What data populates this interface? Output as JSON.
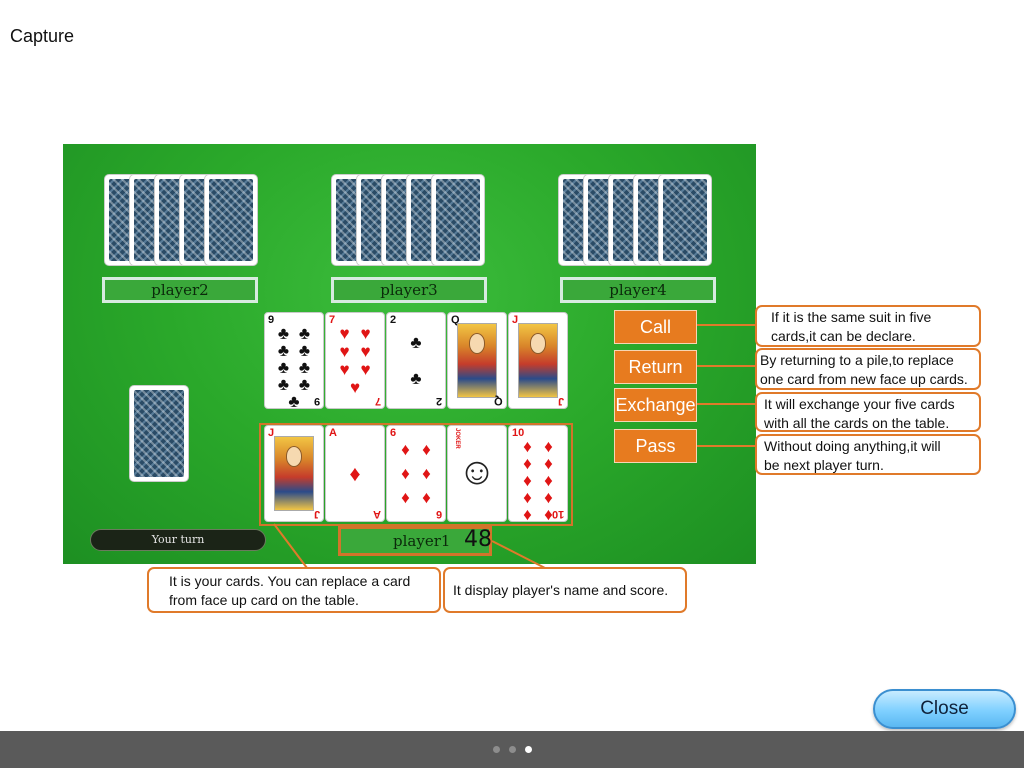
{
  "page": {
    "title": "Capture"
  },
  "opponents": [
    {
      "name": "player2"
    },
    {
      "name": "player3"
    },
    {
      "name": "player4"
    }
  ],
  "table_cards": [
    {
      "rank": "9",
      "suit": "clubs"
    },
    {
      "rank": "7",
      "suit": "hearts"
    },
    {
      "rank": "2",
      "suit": "clubs"
    },
    {
      "rank": "Q",
      "suit": "clubs"
    },
    {
      "rank": "J",
      "suit": "hearts"
    }
  ],
  "hand_cards": [
    {
      "rank": "J",
      "suit": "diamonds"
    },
    {
      "rank": "A",
      "suit": "diamonds"
    },
    {
      "rank": "6",
      "suit": "diamonds"
    },
    {
      "rank": "JOKER",
      "suit": "joker"
    },
    {
      "rank": "10",
      "suit": "diamonds"
    }
  ],
  "player1": {
    "name": "player1",
    "score": "48"
  },
  "turn_indicator": "Your turn",
  "actions": [
    {
      "label": "Call",
      "description_line1": "If it is the same suit in five",
      "description_line2": "cards,it can be declare."
    },
    {
      "label": "Return",
      "description_line1": "By returning to a pile,to replace",
      "description_line2": "one card from new face up cards."
    },
    {
      "label": "Exchange",
      "description_line1": "It will exchange your five cards",
      "description_line2": "with all the cards on the table."
    },
    {
      "label": "Pass",
      "description_line1": "Without doing anything,it will",
      "description_line2": "be next player turn."
    }
  ],
  "callouts": {
    "hand_line1": "It is your cards. You can replace a card",
    "hand_line2": "from face up card on the table.",
    "score": "It display player's name and score."
  },
  "close_label": "Close",
  "pager": {
    "pages": 3,
    "current": 3
  },
  "colors": {
    "table_green": "#2aa82a",
    "accent_orange": "#e77b1f",
    "close_blue": "#7fd0ff"
  }
}
